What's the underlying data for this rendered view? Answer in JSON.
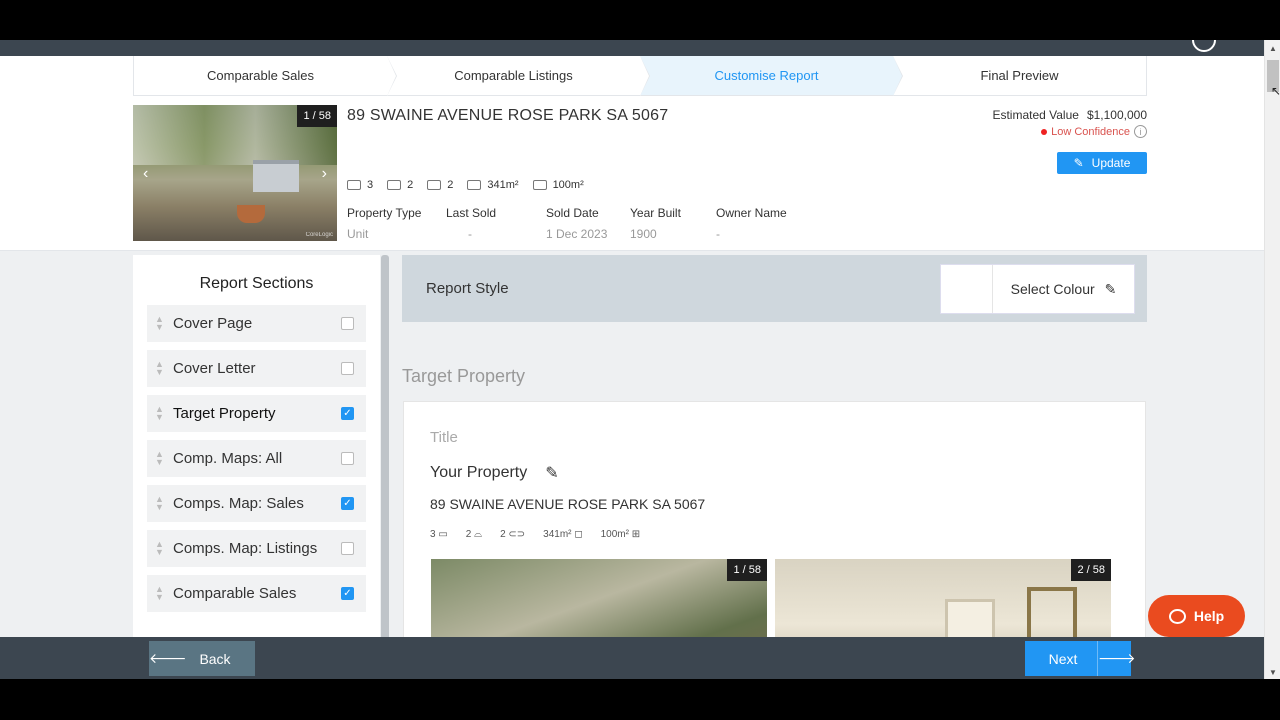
{
  "steps": [
    "Comparable Sales",
    "Comparable Listings",
    "Customise Report",
    "Final Preview"
  ],
  "active_step": "Customise Report",
  "property": {
    "photo_counter": "1 / 58",
    "photo_watermark": "CoreLogic",
    "address": "89 SWAINE AVENUE ROSE PARK SA 5067",
    "beds": "3",
    "baths": "2",
    "cars": "2",
    "land": "341m²",
    "floor": "100m²",
    "facts": [
      {
        "key": "Property Type",
        "value": "Unit"
      },
      {
        "key": "Last Sold",
        "value": "-"
      },
      {
        "key": "Sold Date",
        "value": "1 Dec 2023"
      },
      {
        "key": "Year Built",
        "value": "1900"
      },
      {
        "key": "Owner Name",
        "value": "-"
      }
    ],
    "estimated_label": "Estimated Value",
    "estimated_value": "$1,100,000",
    "confidence": "Low Confidence",
    "update_label": "Update"
  },
  "sidebar": {
    "title": "Report Sections",
    "items": [
      {
        "label": "Cover Page",
        "checked": false
      },
      {
        "label": "Cover Letter",
        "checked": false
      },
      {
        "label": "Target Property",
        "checked": true
      },
      {
        "label": "Comp. Maps: All",
        "checked": false
      },
      {
        "label": "Comps. Map: Sales",
        "checked": true
      },
      {
        "label": "Comps. Map: Listings",
        "checked": false
      },
      {
        "label": "Comparable Sales",
        "checked": true
      }
    ]
  },
  "report_style": {
    "label": "Report Style",
    "select_colour": "Select Colour"
  },
  "target_property": {
    "heading": "Target Property",
    "title_label": "Title",
    "title_value": "Your Property",
    "address": "89 SWAINE AVENUE ROSE PARK SA 5067",
    "beds": "3",
    "baths": "2",
    "cars": "2",
    "land": "341m²",
    "floor": "100m²",
    "image1_counter": "1 / 58",
    "image2_counter": "2 / 58"
  },
  "footer": {
    "back_label": "Back",
    "next_label": "Next"
  },
  "help_label": "Help",
  "colors": {
    "accent": "#2196f3",
    "help": "#ea4b1f",
    "dark_bar": "#3c4650",
    "back_button": "#5a7583"
  }
}
